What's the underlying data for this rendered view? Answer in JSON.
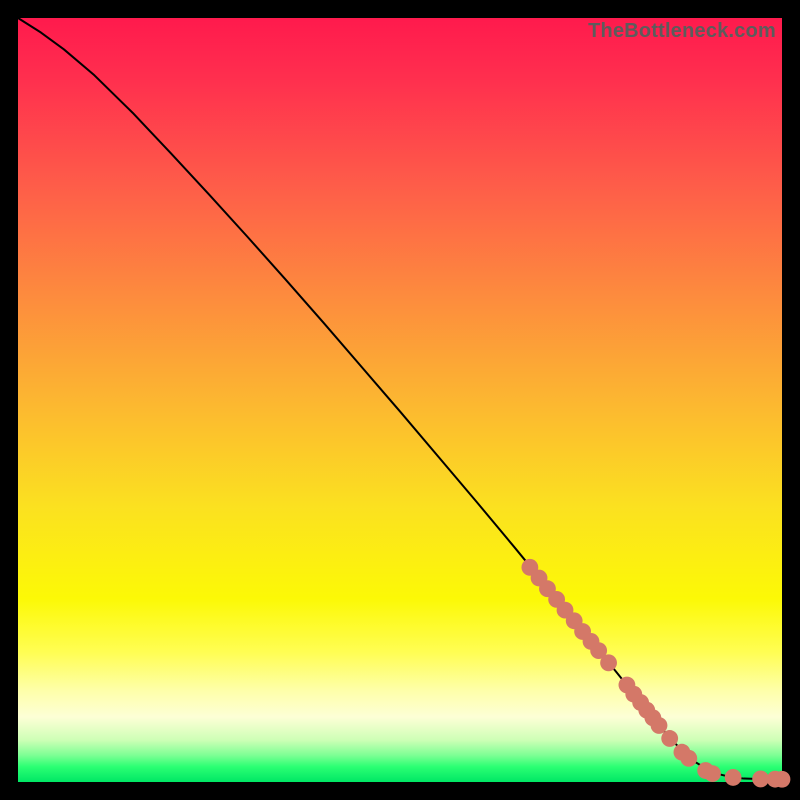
{
  "watermark": "TheBottleneck.com",
  "colors": {
    "curve": "#000000",
    "marker_fill": "#d47868",
    "marker_stroke": "#b85b4e",
    "background_black": "#000000"
  },
  "chart_data": {
    "type": "line",
    "xlabel": "",
    "ylabel": "",
    "title": "",
    "xlim": [
      0,
      100
    ],
    "ylim": [
      0,
      100
    ],
    "grid": false,
    "series": [
      {
        "name": "curve",
        "x": [
          0,
          3,
          6,
          10,
          15,
          20,
          25,
          30,
          35,
          40,
          45,
          50,
          55,
          60,
          65,
          70,
          75,
          80,
          85,
          88,
          91,
          93.5,
          95,
          97,
          98.5,
          100
        ],
        "y": [
          100,
          98.1,
          95.9,
          92.5,
          87.6,
          82.3,
          76.9,
          71.4,
          65.8,
          60.1,
          54.3,
          48.5,
          42.6,
          36.7,
          30.7,
          24.6,
          18.5,
          12.3,
          6.1,
          3.0,
          1.2,
          0.6,
          0.45,
          0.4,
          0.38,
          0.36
        ]
      }
    ],
    "markers": {
      "name": "highlighted-points",
      "x": [
        67.0,
        68.2,
        69.3,
        70.5,
        71.6,
        72.8,
        73.9,
        75.0,
        76.0,
        77.3,
        79.7,
        80.6,
        81.5,
        82.3,
        83.1,
        83.9,
        85.3,
        86.9,
        87.8,
        90.0,
        90.9,
        93.6,
        97.2,
        99.1,
        100.0
      ],
      "y": [
        28.1,
        26.7,
        25.3,
        23.9,
        22.5,
        21.1,
        19.7,
        18.4,
        17.2,
        15.6,
        12.7,
        11.5,
        10.4,
        9.4,
        8.4,
        7.4,
        5.7,
        3.9,
        3.1,
        1.5,
        1.1,
        0.6,
        0.4,
        0.37,
        0.36
      ],
      "radius": 8.4
    }
  }
}
